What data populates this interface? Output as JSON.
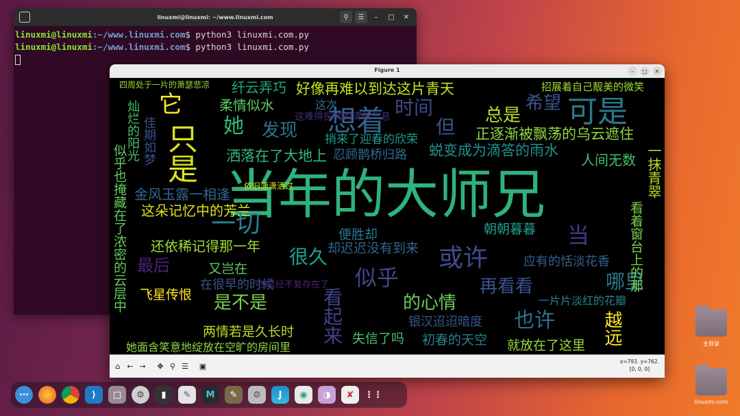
{
  "terminal": {
    "title": "linuxmi@linuxmi: ~/www.linuxmi.com",
    "lines": [
      {
        "user": "linuxmi@linuxmi",
        "path": ":~/www.linuxmi.com",
        "cmd": "$ python3 linuxmi.com.py"
      },
      {
        "user": "linuxmi@linuxmi",
        "path": ":~/www.linuxmi.com",
        "cmd": "$ python3 linuxmi.com.py"
      }
    ]
  },
  "figure": {
    "title": "Figure 1",
    "coord_line1": "x=793. y=762.",
    "coord_line2": "[0, 0, 0]",
    "words": [
      {
        "t": "当年的大师兄",
        "c": "#2fb27c"
      },
      {
        "t": "只是",
        "c": "#d8e21f"
      },
      {
        "t": "想着",
        "c": "#33638d"
      },
      {
        "t": "可是",
        "c": "#2a788e"
      },
      {
        "t": "希望",
        "c": "#39558c"
      },
      {
        "t": "好像再难以到达这片青天",
        "c": "#c7e020"
      },
      {
        "t": "纤云弄巧",
        "c": "#22a884"
      },
      {
        "t": "时间",
        "c": "#3e4989"
      },
      {
        "t": "总是",
        "c": "#b5de2b"
      },
      {
        "t": "发现",
        "c": "#2c728e"
      },
      {
        "t": "她",
        "c": "#35b779"
      },
      {
        "t": "它",
        "c": "#fde725"
      },
      {
        "t": "柔情似水",
        "c": "#5ec962"
      },
      {
        "t": "但",
        "c": "#3b528b"
      },
      {
        "t": "正逐渐被飘荡的乌云遮住",
        "c": "#90d743"
      },
      {
        "t": "蜕变成为滴答的雨水",
        "c": "#21918c"
      },
      {
        "t": "洒落在了大地上",
        "c": "#35b779"
      },
      {
        "t": "人间无数",
        "c": "#46c06f"
      },
      {
        "t": "一抹青翠",
        "c": "#b5de2b"
      },
      {
        "t": "金风玉露一相逢",
        "c": "#31688e"
      },
      {
        "t": "这朵记忆中的芳兰",
        "c": "#dde318"
      },
      {
        "t": "一切",
        "c": "#26828e"
      },
      {
        "t": "朝朝暮暮",
        "c": "#1f9e89"
      },
      {
        "t": "当",
        "c": "#443a83"
      },
      {
        "t": "还依稀记得那一年",
        "c": "#a0da39"
      },
      {
        "t": "很久",
        "c": "#1fa187"
      },
      {
        "t": "或许",
        "c": "#3e4c8a"
      },
      {
        "t": "最后",
        "c": "#482677"
      },
      {
        "t": "又岂在",
        "c": "#5ec962"
      },
      {
        "t": "似乎",
        "c": "#414487"
      },
      {
        "t": "应有的恬淡花香",
        "c": "#33638d"
      },
      {
        "t": "哪里",
        "c": "#2a788e"
      },
      {
        "t": "飞星传恨",
        "c": "#fde725"
      },
      {
        "t": "是不是",
        "c": "#7ad151"
      },
      {
        "t": "再看看",
        "c": "#3b528b"
      },
      {
        "t": "的心情",
        "c": "#6ccd5a"
      },
      {
        "t": "也许",
        "c": "#2c728e"
      },
      {
        "t": "看起来",
        "c": "#404387"
      },
      {
        "t": "越远",
        "c": "#fde725"
      },
      {
        "t": "两情若是久长时",
        "c": "#b8de29"
      },
      {
        "t": "失信了吗",
        "c": "#46c06f"
      },
      {
        "t": "初春的天空",
        "c": "#25848e"
      },
      {
        "t": "就放在了这里",
        "c": "#9bd93c"
      },
      {
        "t": "她面含笑意地绽放在空旷的房间里",
        "c": "#90d743"
      },
      {
        "t": "银汉迢迢暗度",
        "c": "#39568c"
      },
      {
        "t": "一片片淡红的花瓣",
        "c": "#26828e"
      },
      {
        "t": "便胜却",
        "c": "#2a788e"
      },
      {
        "t": "却迟迟没有到来",
        "c": "#33638d"
      },
      {
        "t": "忍顾鹊桥归路",
        "c": "#2e6e8e"
      },
      {
        "t": "捎来了迎春的欣荣",
        "c": "#1f9a8a"
      },
      {
        "t": "灿烂的阳光",
        "c": "#4ac16d"
      },
      {
        "t": "佳期如梦",
        "c": "#3b528b"
      },
      {
        "t": "似乎也掩藏在了浓密的云层中",
        "c": "#65cb5e"
      },
      {
        "t": "看着窗台上的那",
        "c": "#7ad151"
      },
      {
        "t": "招展着自己靓美的微笑",
        "c": "#a0da39"
      },
      {
        "t": "四周处于一片的萧瑟悲凉",
        "c": "#9bd93c"
      },
      {
        "t": "这次",
        "c": "#2d708e"
      },
      {
        "t": "这难得探究的清新气息",
        "c": "#472d7b"
      },
      {
        "t": "依旧潇潇洒过",
        "c": "#d2e21b"
      },
      {
        "t": "在很早的时候",
        "c": "#3b528b"
      },
      {
        "t": "也已经不复存在了",
        "c": "#482677"
      }
    ]
  },
  "dock": {
    "items": [
      "apps-grid-button",
      "firefox-icon",
      "chrome-icon",
      "vscode-icon",
      "files-icon",
      "settings-icon",
      "terminal-icon",
      "text-editor-icon",
      "manjaro-icon",
      "gimp-icon",
      "software-icon",
      "jetbrains-icon",
      "map-icon",
      "toggle-icon",
      "script-icon",
      "show-apps-icon"
    ]
  },
  "desktop": {
    "home_label": "主目录",
    "site_label": "linuxmi.com"
  }
}
